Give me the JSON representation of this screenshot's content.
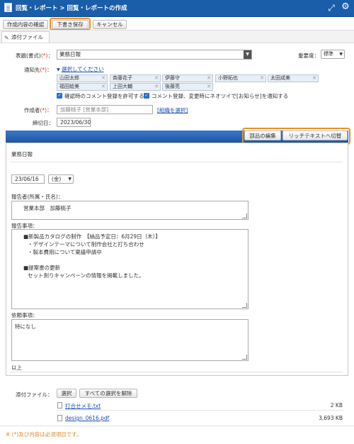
{
  "titlebar": {
    "title": "回覧・レポート > 回覧・レポートの作成",
    "expand_icon": "expand-icon",
    "gear_icon": "gear-icon"
  },
  "toolbar": {
    "confirm_label": "作成内容の確認",
    "draft_label": "下書き保存",
    "cancel_label": "キャンセル"
  },
  "attach_tab": {
    "label": "添付ファイル",
    "icon": "paperclip-icon"
  },
  "form": {
    "subject_label": "表題(書式)",
    "req_mark": "(*)",
    "subject_value": "業務日報",
    "priority_label": "重要度：",
    "priority_value": "標準",
    "recipients_label": "通知先",
    "select_link": "選択してください",
    "recipients": [
      "山田太郎",
      "斉藤花子",
      "伊藤守",
      "小野拓也",
      "太田成美",
      "福田絵美",
      "上田大輔",
      "後藤亮"
    ],
    "opt1": "確認時のコメント登録を許可する",
    "opt2": "コメント登録、変更時にネオツイで[お知らせ]を通知する",
    "author_label": "作成者",
    "author_value": "加藤桃子 [営業本部]",
    "org_link": "[組織を選択]",
    "deadline_label": "締切日：",
    "deadline_value": "2023/06/30"
  },
  "editor_bar": {
    "parts_btn": "部品の編集",
    "richtext_btn": "リッチテキストへ切替"
  },
  "editor": {
    "heading": "業務日報",
    "date_value": "23/06/16",
    "weekday_value": "(金)",
    "reporter_label": "報告者(所属・氏名)：",
    "reporter_value": "営業本部　加藤桃子",
    "report_label": "報告事項：",
    "report_lines": [
      "■新製品カタログの制作　【納品予定日：6月29日（木）】",
      "・デザインテーマについて制作会社と打ち合わせ",
      "・製本費用について稟議申請中",
      "",
      "■提案書の更新",
      "セット割りキャンペーンの情報を掲載しました。"
    ],
    "request_label": "依頼事項：",
    "request_value": "特になし",
    "footer_text": "以上"
  },
  "attachments": {
    "label": "添付ファイル：",
    "select_btn": "選択",
    "clear_btn": "すべての選択を解除",
    "files": [
      {
        "name": "打合せメモ.txt",
        "size": "2 KB"
      },
      {
        "name": "design_0616.pdf",
        "size": "3,693 KB"
      }
    ]
  },
  "note": "※ (*)及び内容は必須項目です。"
}
